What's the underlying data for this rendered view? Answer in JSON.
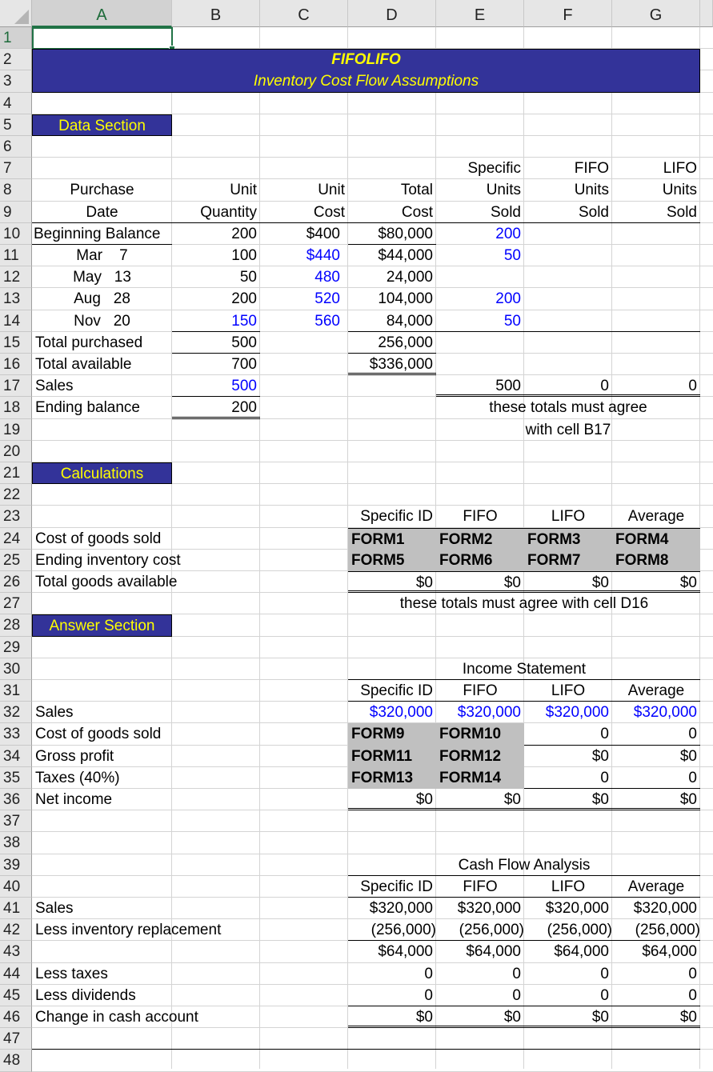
{
  "columns": [
    "A",
    "B",
    "C",
    "D",
    "E",
    "F",
    "G"
  ],
  "rows": [
    "1",
    "2",
    "3",
    "4",
    "5",
    "6",
    "7",
    "8",
    "9",
    "10",
    "11",
    "12",
    "13",
    "14",
    "15",
    "16",
    "17",
    "18",
    "19",
    "20",
    "21",
    "22",
    "23",
    "24",
    "25",
    "26",
    "27",
    "28",
    "29",
    "30",
    "31",
    "32",
    "33",
    "34",
    "35",
    "36",
    "37",
    "38",
    "39",
    "40",
    "41",
    "42",
    "43",
    "44",
    "45",
    "46",
    "47",
    "48"
  ],
  "selected_cell": "A1",
  "title": {
    "line1": "FIFOLIFO",
    "line2": "Inventory Cost Flow Assumptions"
  },
  "sections": {
    "data": "Data Section",
    "calculations": "Calculations",
    "answer": "Answer Section"
  },
  "data_section": {
    "headers": {
      "row7": {
        "E": "Specific",
        "F": "FIFO",
        "G": "LIFO"
      },
      "row8": {
        "A": "Purchase",
        "B": "Unit",
        "C": "Unit",
        "D": "Total",
        "E": "Units",
        "F": "Units",
        "G": "Units"
      },
      "row9": {
        "A": "Date",
        "B": "Quantity",
        "C": "Cost",
        "D": "Cost",
        "E": "Sold",
        "F": "Sold",
        "G": "Sold"
      }
    },
    "purchases": [
      {
        "date": "Beginning Balance",
        "qty": "200",
        "unit_cost": "$400",
        "total_cost": "$80,000",
        "specific": "200",
        "fifo": "",
        "lifo": ""
      },
      {
        "date": "Mar    7",
        "qty": "100",
        "unit_cost": "$440",
        "total_cost": "$44,000",
        "specific": "50",
        "fifo": "",
        "lifo": ""
      },
      {
        "date": "May   13",
        "qty": "50",
        "unit_cost": "480",
        "total_cost": "24,000",
        "specific": "",
        "fifo": "",
        "lifo": ""
      },
      {
        "date": "Aug   28",
        "qty": "200",
        "unit_cost": "520",
        "total_cost": "104,000",
        "specific": "200",
        "fifo": "",
        "lifo": ""
      },
      {
        "date": "Nov   20",
        "qty": "150",
        "unit_cost": "560",
        "total_cost": "84,000",
        "specific": "50",
        "fifo": "",
        "lifo": ""
      }
    ],
    "total_purchased": {
      "label": "Total purchased",
      "qty": "500",
      "total_cost": "256,000"
    },
    "total_available": {
      "label": "Total available",
      "qty": "700",
      "total_cost": "$336,000"
    },
    "sales": {
      "label": "Sales",
      "qty": "500",
      "specific": "500",
      "fifo": "0",
      "lifo": "0"
    },
    "ending_balance": {
      "label": "Ending balance",
      "qty": "200"
    },
    "note1": "these totals must agree",
    "note2": "with cell B17"
  },
  "calculations": {
    "headers": [
      "Specific ID",
      "FIFO",
      "LIFO",
      "Average"
    ],
    "rows": [
      {
        "label": "Cost of goods sold",
        "values": [
          "FORM1",
          "FORM2",
          "FORM3",
          "FORM4"
        ]
      },
      {
        "label": "Ending inventory cost",
        "values": [
          "FORM5",
          "FORM6",
          "FORM7",
          "FORM8"
        ]
      },
      {
        "label": "Total goods available",
        "values": [
          "$0",
          "$0",
          "$0",
          "$0"
        ]
      }
    ],
    "note": "these totals must agree with cell D16"
  },
  "income_statement": {
    "title": "Income Statement",
    "headers": [
      "Specific ID",
      "FIFO",
      "LIFO",
      "Average"
    ],
    "rows": [
      {
        "label": "Sales",
        "values": [
          "$320,000",
          "$320,000",
          "$320,000",
          "$320,000"
        ]
      },
      {
        "label": "Cost of goods sold",
        "values": [
          "FORM9",
          "FORM10",
          "0",
          "0"
        ]
      },
      {
        "label": "Gross profit",
        "values": [
          "FORM11",
          "FORM12",
          "$0",
          "$0"
        ]
      },
      {
        "label": "Taxes (40%)",
        "values": [
          "FORM13",
          "FORM14",
          "0",
          "0"
        ]
      },
      {
        "label": "Net income",
        "values": [
          "$0",
          "$0",
          "$0",
          "$0"
        ]
      }
    ]
  },
  "cash_flow": {
    "title": "Cash Flow Analysis",
    "headers": [
      "Specific ID",
      "FIFO",
      "LIFO",
      "Average"
    ],
    "rows": [
      {
        "label": "Sales",
        "values": [
          "$320,000",
          "$320,000",
          "$320,000",
          "$320,000"
        ]
      },
      {
        "label": "Less inventory replacement",
        "values": [
          "(256,000)",
          "(256,000)",
          "(256,000)",
          "(256,000)"
        ]
      },
      {
        "label": "",
        "values": [
          "$64,000",
          "$64,000",
          "$64,000",
          "$64,000"
        ]
      },
      {
        "label": "Less taxes",
        "values": [
          "0",
          "0",
          "0",
          "0"
        ]
      },
      {
        "label": "Less dividends",
        "values": [
          "0",
          "0",
          "0",
          "0"
        ]
      },
      {
        "label": "Change in cash account",
        "values": [
          "$0",
          "$0",
          "$0",
          "$0"
        ]
      }
    ]
  },
  "colors": {
    "header_fill": "#333399",
    "header_text": "#ffff00",
    "input_blue": "#0000ff",
    "formula_fill": "#c0c0c0",
    "selection": "#217346"
  }
}
